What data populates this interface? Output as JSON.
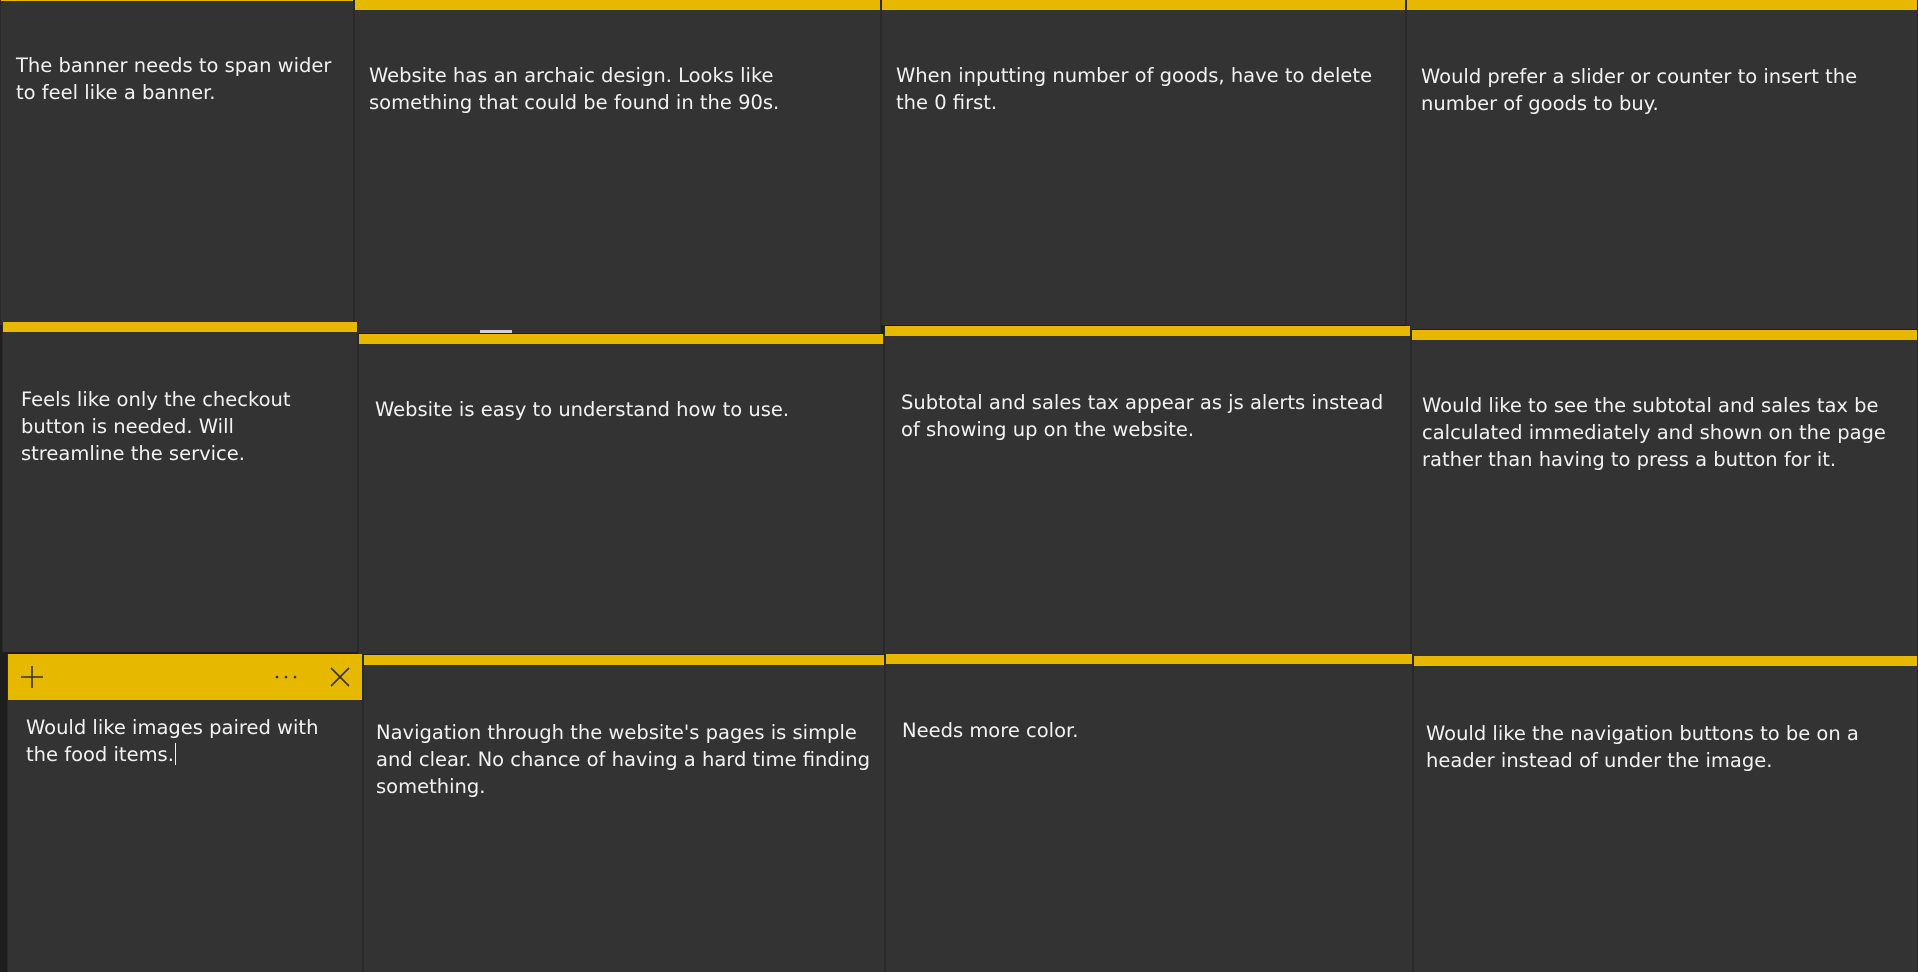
{
  "colors": {
    "note_background": "#333333",
    "note_accent": "#e6b800",
    "note_text": "#f2f2f2",
    "desktop_background": "#1e1e1e"
  },
  "notes": [
    {
      "text": "The banner needs to span wider to feel like a banner."
    },
    {
      "text": "Website has an archaic design. Looks like something that could be found in the 90s."
    },
    {
      "text": "When inputting number of goods, have to delete the 0 first."
    },
    {
      "text": "Would prefer a slider or counter to insert the number of goods to buy."
    },
    {
      "text": "Feels like only the checkout button is needed. Will streamline the service."
    },
    {
      "text": "Website is easy to understand how to use."
    },
    {
      "text": "Subtotal and sales tax appear as js alerts instead of showing up on the website."
    },
    {
      "text": "Would like to see the subtotal and sales tax be calculated immediately and shown on the page rather than having to press a button for it."
    },
    {
      "text": "Would like images paired with the food items."
    },
    {
      "text": "Navigation through the website's pages is simple and clear. No chance of having a hard time finding something."
    },
    {
      "text": "Needs more color."
    },
    {
      "text": "Would like the navigation buttons to be on a header instead of under the image."
    }
  ],
  "active_note_toolbar": {
    "add_icon": "plus-icon",
    "menu_icon": "ellipsis-icon",
    "close_icon": "close-icon"
  }
}
